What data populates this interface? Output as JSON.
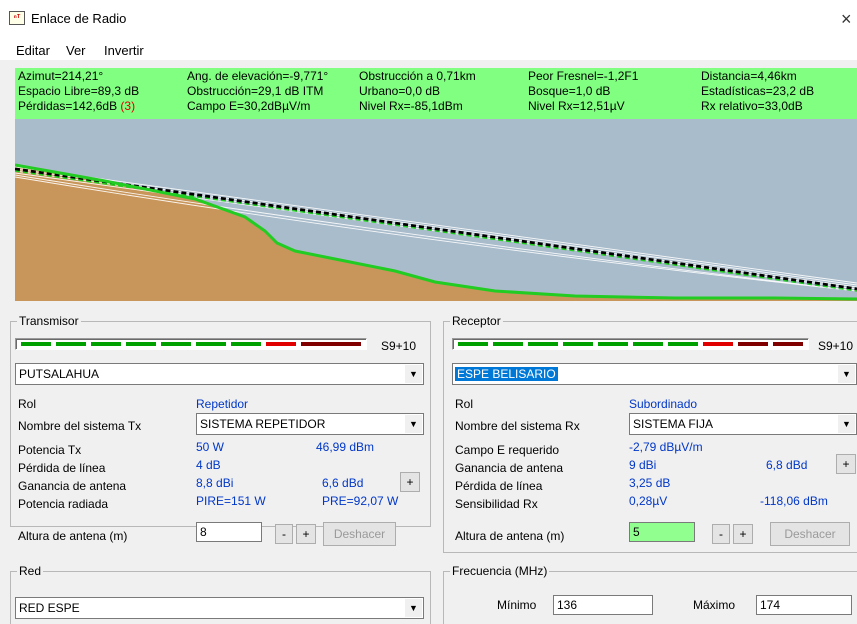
{
  "window": {
    "title": "Enlace de Radio",
    "icon": "radio-link-app-icon",
    "close_glyph": "×"
  },
  "menu": [
    "Editar",
    "Ver",
    "Invertir"
  ],
  "stats": {
    "azimut": "Azimut=214,21°",
    "elevacion": "Ang. de elevación=-9,771°",
    "obstruccion_km": "Obstrucción a 0,71km",
    "peor_fresnel": "Peor Fresnel=-1,2F1",
    "distancia": "Distancia=4,46km",
    "espacio_libre": "Espacio Libre=89,3 dB",
    "obstruccion_db": "Obstrucción=29,1 dB ITM",
    "urbano": "Urbano=0,0 dB",
    "bosque": "Bosque=1,0 dB",
    "estadisticas": "Estadísticas=23,2 dB",
    "perdidas": "Pérdidas=142,6dB",
    "perdidas_flag": "(3)",
    "campo_e": "Campo E=30,2dBµV/m",
    "nivel_rx_dbm": "Nivel Rx=-85,1dBm",
    "nivel_rx_uv": "Nivel Rx=12,51µV",
    "rx_relativo": "Rx relativo=33,0dB"
  },
  "colors": {
    "stat_bg": "#80ff80",
    "terrain": "#c8955a",
    "sky": "#a9bccb",
    "ground_line": "#22cc22",
    "meter_green": "#00a000",
    "meter_red": "#e00000",
    "meter_darkred": "#800000"
  },
  "transmisor": {
    "title": "Transmisor",
    "meter_value": "S9+10",
    "site": "PUTSALAHUA",
    "rol_label": "Rol",
    "rol_value": "Repetidor",
    "sistema_label": "Nombre del sistema Tx",
    "sistema_value": "SISTEMA REPETIDOR",
    "potencia_label": "Potencia Tx",
    "potencia_w": "50 W",
    "potencia_dbm": "46,99 dBm",
    "perdida_label": "Pérdida de línea",
    "perdida_value": "4 dB",
    "ganancia_label": "Ganancia de antena",
    "ganancia_dbi": "8,8 dBi",
    "ganancia_dbd": "6,6 dBd",
    "radiada_label": "Potencia radiada",
    "pire": "PIRE=151 W",
    "pre": "PRE=92,07 W",
    "altura_label": "Altura de antena (m)",
    "altura_value": "8",
    "minus": "-",
    "plus": "+",
    "deshacer": "Deshacer"
  },
  "receptor": {
    "title": "Receptor",
    "meter_value": "S9+10",
    "site": "ESPE BELISARIO",
    "rol_label": "Rol",
    "rol_value": "Subordinado",
    "sistema_label": "Nombre del sistema Rx",
    "sistema_value": "SISTEMA FIJA",
    "campo_label": "Campo E requerido",
    "campo_value": "-2,79 dBµV/m",
    "ganancia_label": "Ganancia de antena",
    "ganancia_dbi": "9 dBi",
    "ganancia_dbd": "6,8 dBd",
    "perdida_label": "Pérdida de línea",
    "perdida_value": "3,25 dB",
    "sensibilidad_label": "Sensibilidad Rx",
    "sens_uv": "0,28µV",
    "sens_dbm": "-118,06 dBm",
    "altura_label": "Altura de antena (m)",
    "altura_value": "5",
    "minus": "-",
    "plus": "+",
    "deshacer": "Deshacer"
  },
  "red": {
    "title": "Red",
    "value": "RED ESPE"
  },
  "frecuencia": {
    "title": "Frecuencia (MHz)",
    "min_label": "Mínimo",
    "min_value": "136",
    "max_label": "Máximo",
    "max_value": "174"
  }
}
